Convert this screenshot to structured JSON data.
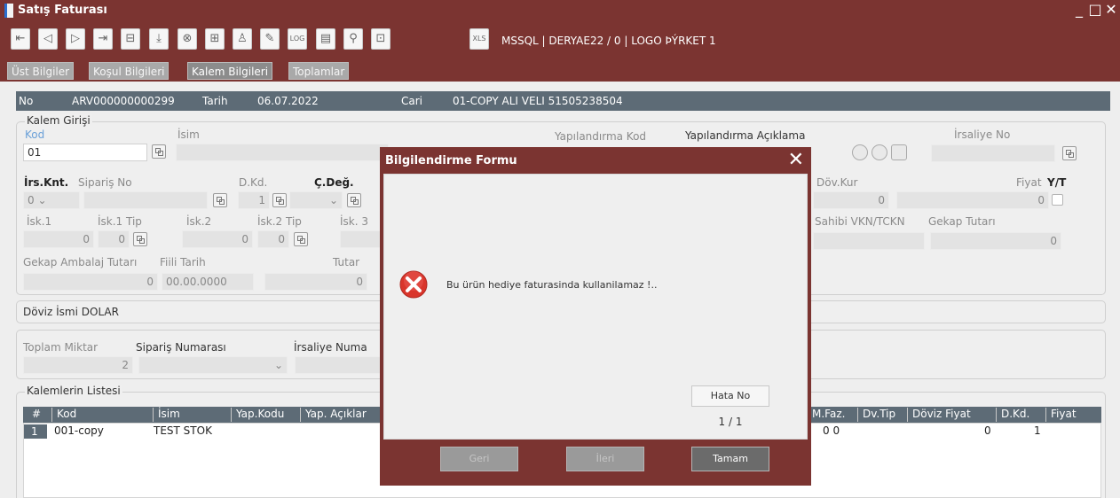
{
  "window": {
    "title": "Satış Faturası",
    "controls": {
      "minimize": "_",
      "maximize": "□",
      "close": "✕"
    }
  },
  "toolbar": {
    "db_info": "MSSQL | DERYAE22 / 0 | LOGO ÞÝRKET 1",
    "log_label": "LOG",
    "xls_label": "XLS"
  },
  "tabs": [
    {
      "label": "Üst Bilgiler"
    },
    {
      "label": "Koşul Bilgileri"
    },
    {
      "label": "Kalem Bilgileri"
    },
    {
      "label": "Toplamlar"
    }
  ],
  "header_bar": {
    "no_label": "No",
    "no_value": "ARV000000000299",
    "tarih_label": "Tarih",
    "tarih_value": "06.07.2022",
    "cari_label": "Cari",
    "cari_value": "01-COPY ALI VELI 51505238504"
  },
  "kalem_girisi": {
    "group_label": "Kalem Girişi",
    "kod_label": "Kod",
    "kod_value": "01",
    "isim_label": "İsim",
    "yap_kod_label": "Yapılandırma Kod",
    "yap_aciklama_label": "Yapılandırma Açıklama",
    "irsaliye_no_label": "İrsaliye No",
    "irs_knt_label": "İrs.Knt.",
    "irs_knt_value": "0",
    "siparis_no_label": "Sipariş No",
    "dkd_label": "D.Kd.",
    "dkd_value": "1",
    "cdeg_label": "Ç.Değ.",
    "dov_kur_label": "Döv.Kur",
    "dov_kur_value": "0",
    "fiyat_label": "Fiyat",
    "yt_label": "Y/T",
    "fiyat_value": "0",
    "isk1_label": "İsk.1",
    "isk1_tip_label": "İsk.1 Tip",
    "isk2_label": "İsk.2",
    "isk2_tip_label": "İsk.2 Tip",
    "isk3_label": "İsk. 3",
    "isk1_value": "0",
    "isk1_tip_value": "0",
    "isk2_value": "0",
    "isk2_tip_value": "0",
    "sahibi_label": "Sahibi VKN/TCKN",
    "gekap_tutari_label": "Gekap Tutarı",
    "gekap_tutari_value": "0",
    "gekap_ambalaj_label": "Gekap Ambalaj Tutarı",
    "fiili_tarih_label": "Fiili Tarih",
    "tutar_label": "Tutar",
    "gekap_ambalaj_value": "0",
    "fiili_tarih_value": "00.00.0000",
    "tutar_value": "0"
  },
  "doviz": {
    "label": "Döviz İsmi DOLAR"
  },
  "toplam": {
    "toplam_miktar_label": "Toplam Miktar",
    "toplam_miktar_value": "2",
    "siparis_numarasi_label": "Sipariş Numarası",
    "irsaliye_numarasi_label": "İrsaliye Numa"
  },
  "kalemler": {
    "group_label": "Kalemlerin Listesi",
    "columns": [
      "#",
      "Kod",
      "İsim",
      "Yap.Kodu",
      "Yap. Açıklar",
      "M.Faz.",
      "Dv.Tip",
      "Döviz Fiyat",
      "D.Kd.",
      "Fiyat"
    ],
    "rows": [
      {
        "no": "1",
        "kod": "001-copy",
        "isim": "TEST STOK",
        "dv_tip": "0 0",
        "doviz_fiyat": "0",
        "dkd": "1"
      }
    ]
  },
  "dialog": {
    "title": "Bilgilendirme Formu",
    "message": "Bu ürün hediye faturasinda kullanilamaz !..",
    "hata_no_label": "Hata No",
    "page_indicator": "1 / 1",
    "geri_label": "Geri",
    "ileri_label": "İleri",
    "tamam_label": "Tamam",
    "close": "✕"
  },
  "colors": {
    "titlebar": "#7b3431",
    "header_bar": "#5d6b76",
    "dialog_frame": "#7b3431",
    "error_icon": "#d9352b"
  }
}
